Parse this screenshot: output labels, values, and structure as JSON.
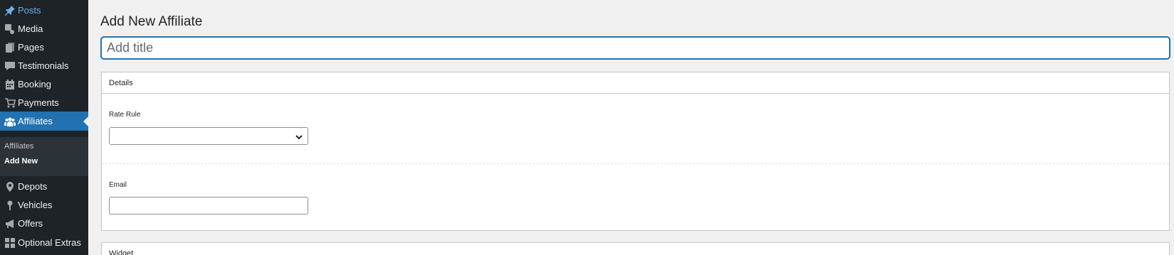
{
  "sidebar": {
    "items": [
      {
        "label": "Posts",
        "icon": "pin-icon"
      },
      {
        "label": "Media",
        "icon": "media-icon"
      },
      {
        "label": "Pages",
        "icon": "pages-icon"
      },
      {
        "label": "Testimonials",
        "icon": "comment-icon"
      },
      {
        "label": "Booking",
        "icon": "calendar-icon"
      },
      {
        "label": "Payments",
        "icon": "cart-icon"
      },
      {
        "label": "Affiliates",
        "icon": "groups-icon"
      },
      {
        "label": "Depots",
        "icon": "location-icon"
      },
      {
        "label": "Vehicles",
        "icon": "pin-marker-icon"
      },
      {
        "label": "Offers",
        "icon": "megaphone-icon"
      },
      {
        "label": "Optional Extras",
        "icon": "grid-icon"
      }
    ],
    "submenu": [
      {
        "label": "Affiliates"
      },
      {
        "label": "Add New"
      }
    ]
  },
  "main": {
    "page_title": "Add New Affiliate",
    "title_placeholder": "Add title",
    "details": {
      "header": "Details",
      "rate_rule_label": "Rate Rule",
      "rate_rule_value": "",
      "email_label": "Email",
      "email_value": ""
    },
    "widget_header": "Widget"
  },
  "colors": {
    "sidebar_bg": "#1d2327",
    "active_bg": "#2271b1",
    "link_blue": "#72aee6",
    "page_bg": "#f0f0f1"
  }
}
